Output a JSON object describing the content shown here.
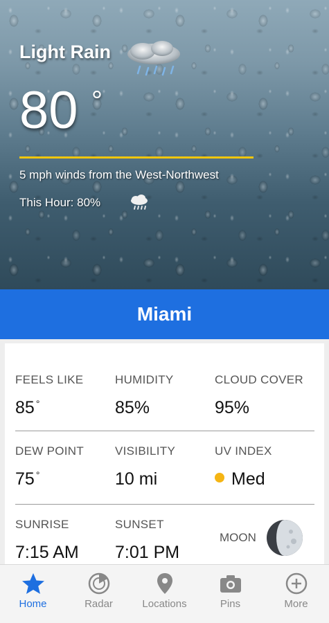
{
  "hero": {
    "condition": "Light Rain",
    "condition_icon": "cloud-rain-icon",
    "temperature": "80",
    "degree_symbol": "°",
    "winds": "5 mph winds from the West-Northwest",
    "this_hour": "This Hour: 80%",
    "this_hour_icon": "rain-cloud-icon",
    "accent_color": "#f3c60c"
  },
  "city": {
    "name": "Miami",
    "bar_color": "#1e6fe0"
  },
  "details": {
    "feels_like": {
      "label": "FEELS LIKE",
      "value": "85"
    },
    "humidity": {
      "label": "HUMIDITY",
      "value": "85%"
    },
    "cloud_cover": {
      "label": "CLOUD COVER",
      "value": "95%"
    },
    "dew_point": {
      "label": "DEW POINT",
      "value": "75"
    },
    "visibility": {
      "label": "VISIBILITY",
      "value": "10 mi"
    },
    "uv_index": {
      "label": "UV INDEX",
      "value": "Med",
      "dot_color": "#f5b514"
    },
    "sunrise": {
      "label": "SUNRISE",
      "value": "7:15 AM"
    },
    "sunset": {
      "label": "SUNSET",
      "value": "7:01 PM"
    },
    "moon": {
      "label": "MOON",
      "icon": "moon-phase-icon"
    }
  },
  "nav": {
    "items": [
      {
        "label": "Home",
        "icon": "star-icon",
        "active": true
      },
      {
        "label": "Radar",
        "icon": "radar-icon",
        "active": false
      },
      {
        "label": "Locations",
        "icon": "location-pin-icon",
        "active": false
      },
      {
        "label": "Pins",
        "icon": "camera-icon",
        "active": false
      },
      {
        "label": "More",
        "icon": "plus-circle-icon",
        "active": false
      }
    ],
    "active_color": "#1e6fe0"
  }
}
